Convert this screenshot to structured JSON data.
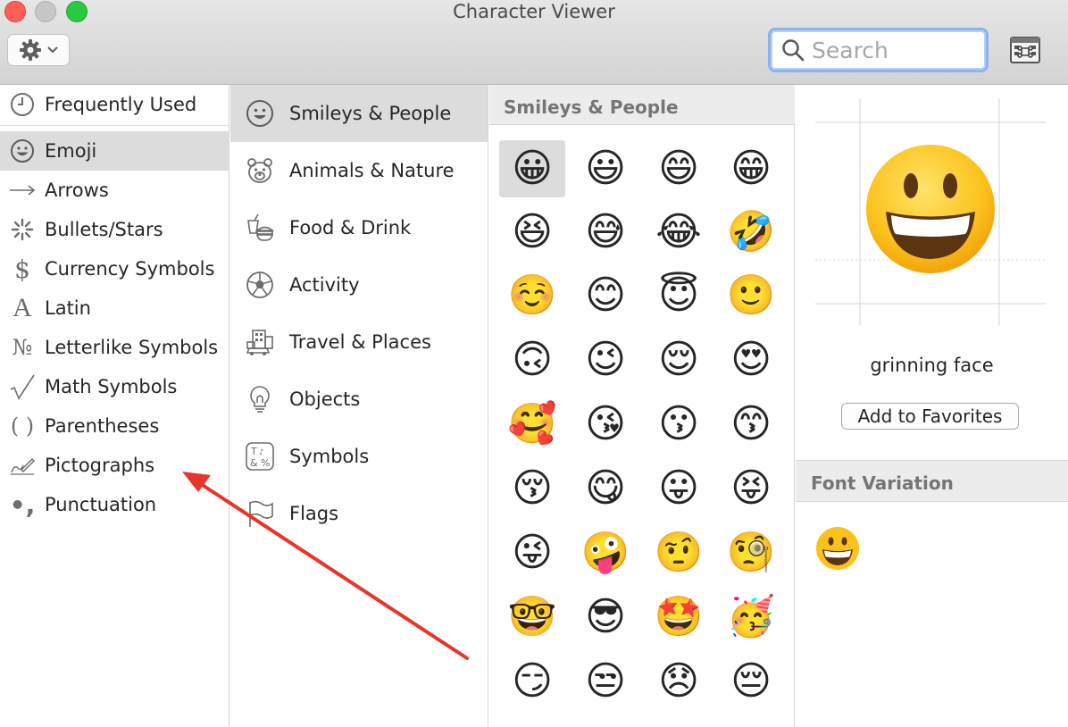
{
  "window": {
    "title": "Character Viewer"
  },
  "toolbar": {
    "action_menu": "gear-icon",
    "search": {
      "placeholder": "Search",
      "value": ""
    },
    "keyboard_viewer_button": "keyboard-viewer-icon"
  },
  "categories": [
    {
      "label": "Frequently Used",
      "icon": "clock-icon"
    },
    {
      "label": "Emoji",
      "icon": "smiley-icon",
      "selected": true
    },
    {
      "label": "Arrows",
      "icon": "arrow-icon"
    },
    {
      "label": "Bullets/Stars",
      "icon": "asterisk-icon"
    },
    {
      "label": "Currency Symbols",
      "icon": "dollar-icon"
    },
    {
      "label": "Latin",
      "icon": "letter-a-icon"
    },
    {
      "label": "Letterlike Symbols",
      "icon": "numero-icon"
    },
    {
      "label": "Math Symbols",
      "icon": "square-root-icon"
    },
    {
      "label": "Parentheses",
      "icon": "parentheses-icon"
    },
    {
      "label": "Pictographs",
      "icon": "pictograph-icon"
    },
    {
      "label": "Punctuation",
      "icon": "punctuation-icon"
    }
  ],
  "emoji_groups": [
    {
      "label": "Smileys & People",
      "icon": "smiley-icon",
      "selected": true
    },
    {
      "label": "Animals & Nature",
      "icon": "bear-icon"
    },
    {
      "label": "Food & Drink",
      "icon": "food-icon"
    },
    {
      "label": "Activity",
      "icon": "soccer-ball-icon"
    },
    {
      "label": "Travel & Places",
      "icon": "building-icon"
    },
    {
      "label": "Objects",
      "icon": "lightbulb-icon"
    },
    {
      "label": "Symbols",
      "icon": "symbols-icon"
    },
    {
      "label": "Flags",
      "icon": "flag-icon"
    }
  ],
  "grid": {
    "title": "Smileys & People",
    "rows": [
      [
        "😀",
        "😃",
        "😄",
        "😁"
      ],
      [
        "😆",
        "😅",
        "😂",
        "🤣"
      ],
      [
        "☺️",
        "😊",
        "😇",
        "🙂"
      ],
      [
        "🙃",
        "😉",
        "😌",
        "😍"
      ],
      [
        "🥰",
        "😘",
        "😗",
        "😙"
      ],
      [
        "😚",
        "😋",
        "😛",
        "😝"
      ],
      [
        "😜",
        "🤪",
        "🤨",
        "🧐"
      ],
      [
        "🤓",
        "😎",
        "🤩",
        "🥳"
      ],
      [
        "😏",
        "😒",
        "😞",
        "😔"
      ]
    ]
  },
  "detail": {
    "character": "😀",
    "name": "grinning face",
    "add_favorites": "Add to Favorites",
    "font_variation_title": "Font Variation",
    "variations": [
      "😀"
    ]
  },
  "colors": {
    "selection": "#dcdcdc",
    "annotation_arrow": "#e8352b",
    "search_focus": "#8ab3ee",
    "emoji_face": "#fbc531"
  }
}
